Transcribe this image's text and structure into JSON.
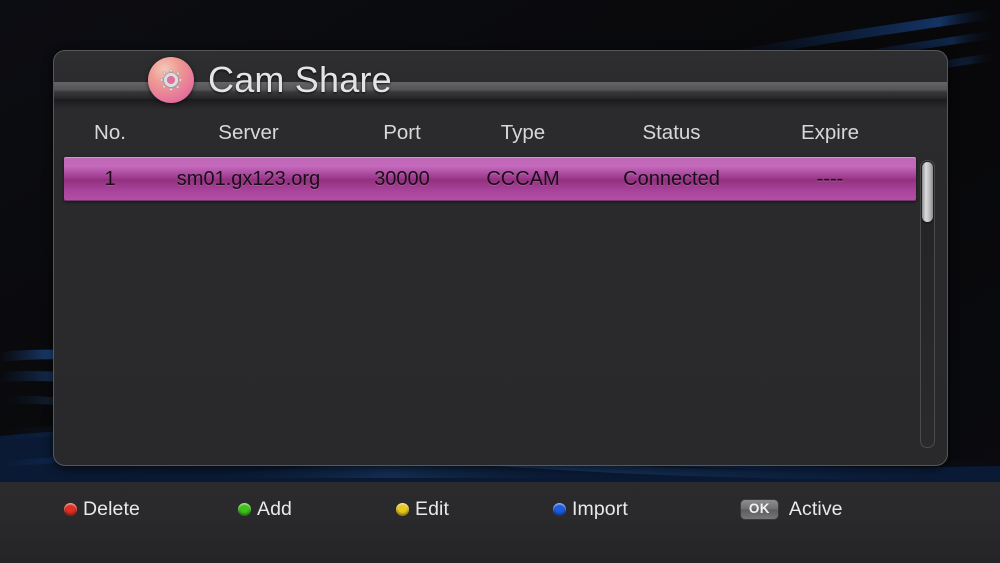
{
  "app": {
    "title": "Cam Share",
    "icon": "gear-icon"
  },
  "table": {
    "headers": {
      "no": "No.",
      "server": "Server",
      "port": "Port",
      "type": "Type",
      "status": "Status",
      "expire": "Expire"
    },
    "rows": [
      {
        "no": "1",
        "server": "sm01.gx123.org",
        "port": "30000",
        "type": "CCCAM",
        "status": "Connected",
        "expire": "----",
        "selected": true
      }
    ]
  },
  "scrollbar": {
    "name": "vertical-scrollbar"
  },
  "footer": {
    "hints": [
      {
        "icon": "red-dot-icon",
        "color": "#e03024",
        "label": "Delete"
      },
      {
        "icon": "green-dot-icon",
        "color": "#3fc21a",
        "label": "Add"
      },
      {
        "icon": "yellow-dot-icon",
        "color": "#e8c91d",
        "label": "Edit"
      },
      {
        "icon": "blue-dot-icon",
        "color": "#1b5ce0",
        "label": "Import"
      }
    ],
    "ok": {
      "badge": "OK",
      "label": "Active"
    }
  },
  "colors": {
    "selection": "#b351a6",
    "panel_bg": "#2b2b2d",
    "accent_icon": "#e5739b",
    "wallpaper": "#0a0a0c"
  }
}
